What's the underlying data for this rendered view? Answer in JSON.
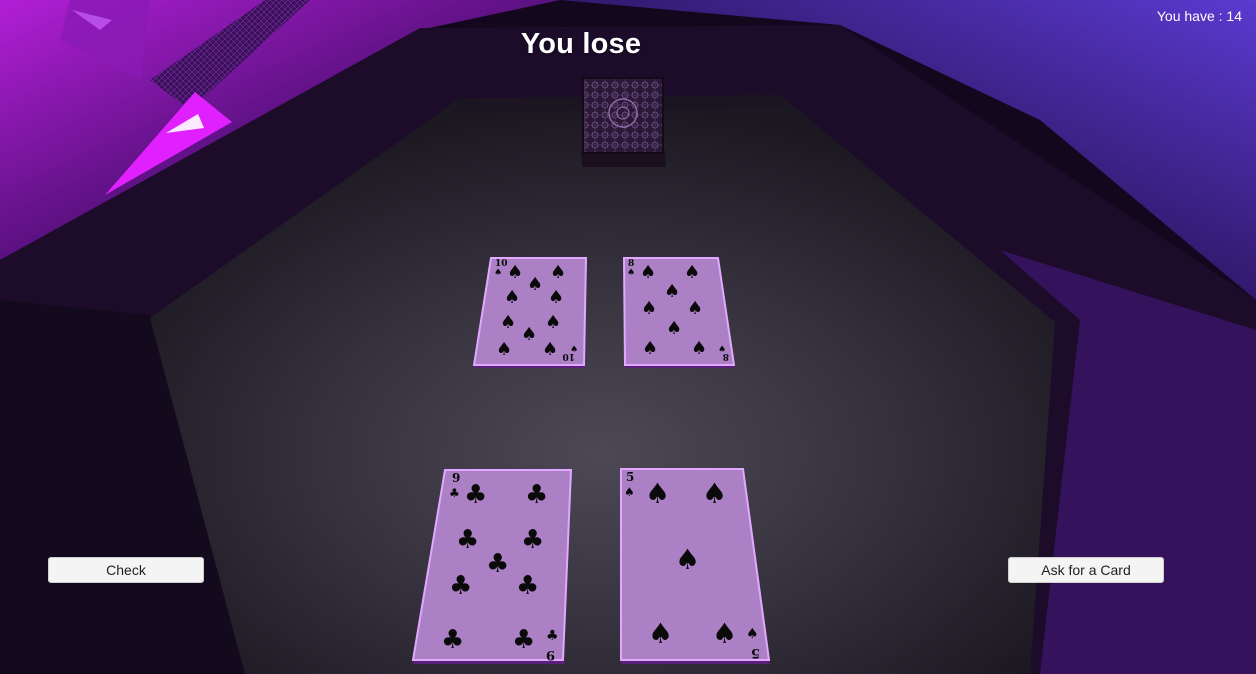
{
  "hud": {
    "result_text": "You lose",
    "score_label": "You have : 14"
  },
  "buttons": {
    "check_label": "Check",
    "ask_label": "Ask for a Card"
  },
  "deck": {
    "face": "down"
  },
  "dealer_hand": [
    {
      "rank": "10",
      "suit": "spades",
      "suit_glyph": "♠"
    },
    {
      "rank": "8",
      "suit": "spades",
      "suit_glyph": "♠"
    }
  ],
  "player_hand": [
    {
      "rank": "9",
      "suit": "clubs",
      "suit_glyph": "♣"
    },
    {
      "rank": "5",
      "suit": "spades",
      "suit_glyph": "♠"
    }
  ],
  "colors": {
    "card_face": "#ac80c5",
    "card_border": "#e2a8ff",
    "neon_accent": "#e020ff",
    "table_felt": "#3a3542"
  },
  "icons": {
    "spades": "spade-icon",
    "clubs": "club-icon"
  }
}
